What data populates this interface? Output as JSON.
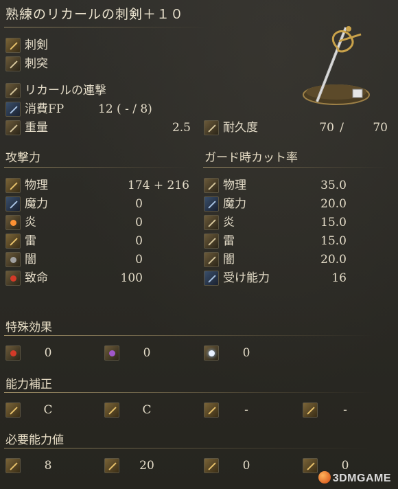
{
  "title": "熟練のリカールの刺剣＋１０",
  "attack_types": [
    "刺剣",
    "刺突"
  ],
  "skill": "リカールの連撃",
  "fp": {
    "label": "消費FP",
    "value": "12 (   - /  8)"
  },
  "weight": {
    "label": "重量",
    "value": "2.5"
  },
  "durability": {
    "label": "耐久度",
    "current": "70",
    "sep": "/",
    "max": "70"
  },
  "attack_power": {
    "heading": "攻撃力",
    "rows": [
      {
        "label": "物理",
        "value": "174 +  216"
      },
      {
        "label": "魔力",
        "value": "0"
      },
      {
        "label": "炎",
        "value": "0"
      },
      {
        "label": "雷",
        "value": "0"
      },
      {
        "label": "闇",
        "value": "0"
      },
      {
        "label": "致命",
        "value": "100"
      }
    ]
  },
  "guard": {
    "heading": "ガード時カット率",
    "rows": [
      {
        "label": "物理",
        "value": "35.0"
      },
      {
        "label": "魔力",
        "value": "20.0"
      },
      {
        "label": "炎",
        "value": "15.0"
      },
      {
        "label": "雷",
        "value": "15.0"
      },
      {
        "label": "闇",
        "value": "20.0"
      },
      {
        "label": "受け能力",
        "value": "16"
      }
    ]
  },
  "special_effects": {
    "heading": "特殊効果",
    "values": [
      "0",
      "0",
      "0"
    ],
    "icons": [
      "bleed-icon",
      "poison-icon",
      "frost-icon"
    ]
  },
  "scaling": {
    "heading": "能力補正",
    "values": [
      "C",
      "C",
      "-",
      "-"
    ],
    "icons": [
      "strength-icon",
      "dexterity-icon",
      "intelligence-icon",
      "faith-icon"
    ]
  },
  "requirements": {
    "heading": "必要能力値",
    "values": [
      "8",
      "20",
      "0",
      "0"
    ],
    "icons": [
      "strength-icon",
      "dexterity-icon",
      "intelligence-icon",
      "faith-icon"
    ]
  },
  "watermark": "3DMGAME"
}
